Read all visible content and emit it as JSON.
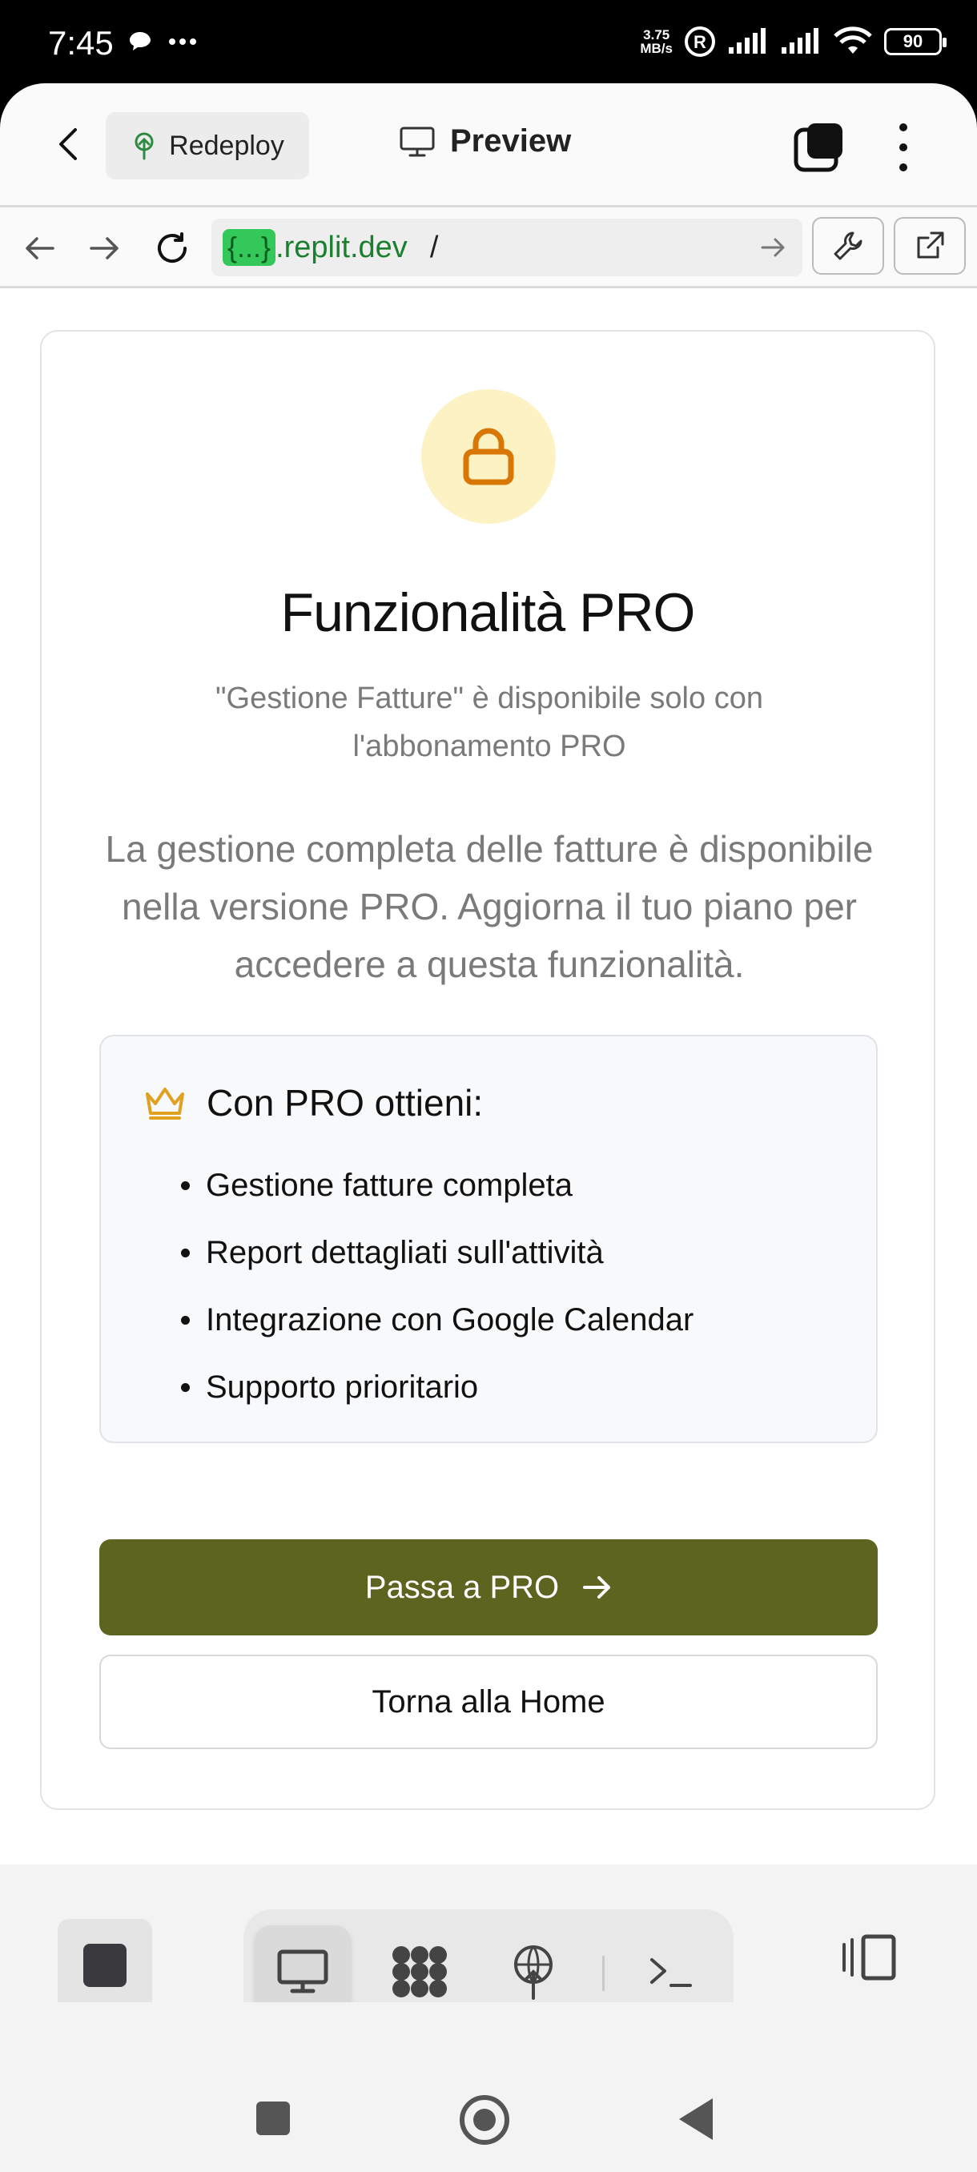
{
  "status_bar": {
    "time": "7:45",
    "net_speed_value": "3.75",
    "net_speed_unit": "MB/s",
    "battery": "90"
  },
  "top_bar": {
    "redeploy_label": "Redeploy",
    "title": "Preview"
  },
  "url_bar": {
    "badge": "{...}",
    "host": ".replit.dev",
    "path": "/"
  },
  "card": {
    "title": "Funzionalità PRO",
    "subtitle": "\"Gestione Fatture\" è disponibile solo con l'abbonamento PRO",
    "description": "La gestione completa delle fatture è disponibile nella versione PRO. Aggiorna il tuo piano per accedere a questa funzionalità.",
    "pro_box": {
      "heading": "Con PRO ottieni:",
      "features": [
        "Gestione fatture completa",
        "Report dettagliati sull'attività",
        "Integrazione con Google Calendar",
        "Supporto prioritario"
      ]
    },
    "primary_button": "Passa a PRO",
    "secondary_button": "Torna alla Home"
  },
  "colors": {
    "accent_olive": "#5c6420",
    "lock_bg": "#fdf2c4",
    "lock_icon": "#d97706",
    "crown": "#e0a020",
    "url_badge": "#34c759"
  },
  "icons": {
    "toolbar": [
      "stop-icon",
      "preview-monitor-icon",
      "workspace-grid-icon",
      "deploy-icon",
      "shell-terminal-icon",
      "layout-toggle-icon"
    ]
  }
}
